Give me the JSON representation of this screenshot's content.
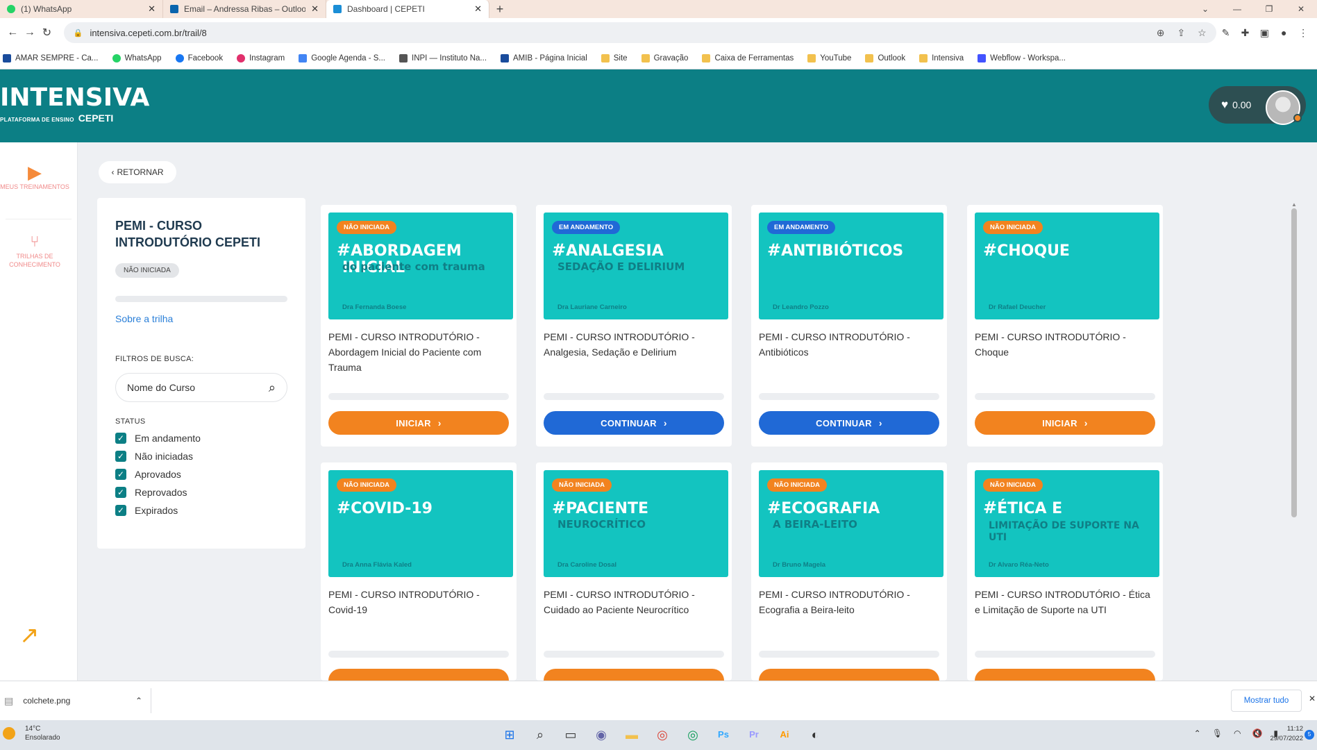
{
  "browser": {
    "tabs": [
      {
        "title": "(1) WhatsApp",
        "color": "#25d366"
      },
      {
        "title": "Email – Andressa Ribas – Outlook",
        "color": "#0a64ad"
      },
      {
        "title": "Dashboard | CEPETI",
        "color": "#1b8ed6"
      }
    ],
    "url": "intensiva.cepeti.com.br/trail/8",
    "bookmarks": [
      {
        "label": "AMAR SEMPRE - Ca...",
        "color": "#1a4c9c"
      },
      {
        "label": "WhatsApp",
        "color": "#25d366"
      },
      {
        "label": "Facebook",
        "color": "#1877f2"
      },
      {
        "label": "Instagram",
        "color": "#e1306c"
      },
      {
        "label": "Google Agenda - S...",
        "color": "#4285f4"
      },
      {
        "label": "INPI — Instituto Na...",
        "color": "#555555"
      },
      {
        "label": "AMIB - Página Inicial",
        "color": "#1a4c9c"
      },
      {
        "label": "Site",
        "color": "#f2c14e"
      },
      {
        "label": "Gravação",
        "color": "#f2c14e"
      },
      {
        "label": "Caixa de Ferramentas",
        "color": "#f2c14e"
      },
      {
        "label": "YouTube",
        "color": "#f2c14e"
      },
      {
        "label": "Outlook",
        "color": "#f2c14e"
      },
      {
        "label": "Intensiva",
        "color": "#f2c14e"
      },
      {
        "label": "Webflow - Workspa...",
        "color": "#4353ff"
      }
    ]
  },
  "header": {
    "logo_main": "INTENSIVA",
    "logo_sub": "PLATAFORMA DE ENSINO",
    "logo_brand": "CEPETI",
    "wallet_amount": "0.00"
  },
  "rail": {
    "item1": "MEUS TREINAMENTOS",
    "item2_line1": "TRILHAS DE",
    "item2_line2": "CONHECIMENTO"
  },
  "back_label": "RETORNAR",
  "trail": {
    "title": "PEMI - CURSO INTRODUTÓRIO CEPETI",
    "status": "NÃO INICIADA",
    "about_link": "Sobre a trilha",
    "filters_label": "FILTROS DE BUSCA:",
    "search_placeholder": "Nome do Curso",
    "status_label": "STATUS",
    "status_options": [
      "Em andamento",
      "Não iniciadas",
      "Aprovados",
      "Reprovados",
      "Expirados"
    ]
  },
  "courses": [
    {
      "badge": "NÃO INICIADA",
      "title": "ABORDAGEM INICIAL",
      "subtitle": "do paciente com trauma",
      "author": "Dra Fernanda Boese",
      "desc": "PEMI - CURSO INTRODUTÓRIO - Abordagem Inicial do Paciente com Trauma",
      "button": "INICIAR",
      "accent": "orange"
    },
    {
      "badge": "EM ANDAMENTO",
      "title": "ANALGESIA",
      "subtitle": "SEDAÇÃO E DELIRIUM",
      "author": "Dra Lauriane Carneiro",
      "desc": "PEMI - CURSO INTRODUTÓRIO - Analgesia, Sedação e Delirium",
      "button": "CONTINUAR",
      "accent": "blue"
    },
    {
      "badge": "EM ANDAMENTO",
      "title": "ANTIBIÓTICOS",
      "subtitle": "",
      "author": "Dr Leandro Pozzo",
      "desc": "PEMI - CURSO INTRODUTÓRIO - Antibióticos",
      "button": "CONTINUAR",
      "accent": "blue"
    },
    {
      "badge": "NÃO INICIADA",
      "title": "CHOQUE",
      "subtitle": "",
      "author": "Dr Rafael Deucher",
      "desc": "PEMI - CURSO INTRODUTÓRIO - Choque",
      "button": "INICIAR",
      "accent": "orange"
    },
    {
      "badge": "NÃO INICIADA",
      "title": "COVID-19",
      "subtitle": "",
      "author": "Dra Anna Flávia Kaled",
      "desc": "PEMI - CURSO INTRODUTÓRIO - Covid-19",
      "button": "",
      "accent": "orange"
    },
    {
      "badge": "NÃO INICIADA",
      "title": "PACIENTE",
      "subtitle": "NEUROCRÍTICO",
      "author": "Dra Caroline Dosal",
      "desc": "PEMI - CURSO INTRODUTÓRIO - Cuidado ao Paciente Neurocrítico",
      "button": "",
      "accent": "orange"
    },
    {
      "badge": "NÃO INICIADA",
      "title": "ECOGRAFIA",
      "subtitle": "A BEIRA-LEITO",
      "author": "Dr Bruno Magela",
      "desc": "PEMI - CURSO INTRODUTÓRIO - Ecografia a Beira-leito",
      "button": "",
      "accent": "orange"
    },
    {
      "badge": "NÃO INICIADA",
      "title": "ÉTICA E",
      "subtitle": "LIMITAÇÃO DE SUPORTE NA UTI",
      "author": "Dr Alvaro Réa-Neto",
      "desc": "PEMI - CURSO INTRODUTÓRIO - Ética e Limitação de Suporte na UTI",
      "button": "",
      "accent": "orange"
    }
  ],
  "download": {
    "file": "colchete.png",
    "show_all": "Mostrar tudo"
  },
  "taskbar": {
    "temp": "14°C",
    "weather": "Ensolarado",
    "time": "11:12",
    "date": "29/07/2022",
    "notif_count": "5"
  }
}
